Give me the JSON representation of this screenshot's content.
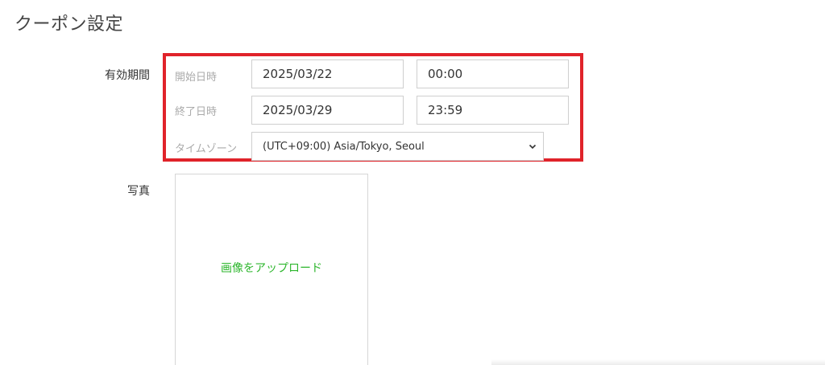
{
  "header": {
    "title": "クーポン設定"
  },
  "validity": {
    "label": "有効期間",
    "start": {
      "label": "開始日時",
      "date": "2025/03/22",
      "time": "00:00"
    },
    "end": {
      "label": "終了日時",
      "date": "2025/03/29",
      "time": "23:59"
    },
    "timezone": {
      "label": "タイムゾーン",
      "selected": "(UTC+09:00) Asia/Tokyo, Seoul"
    }
  },
  "photo": {
    "label": "写真",
    "upload_text": "画像をアップロード"
  },
  "colors": {
    "highlight": "#e0232a",
    "upload_text": "#2db62d"
  },
  "icons": {
    "dropdown": "chevron-down-icon"
  }
}
